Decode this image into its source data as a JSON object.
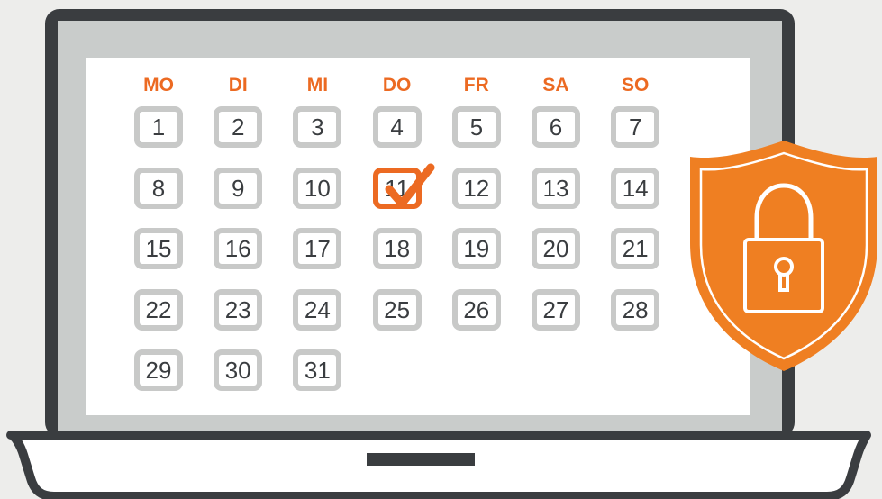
{
  "calendar": {
    "weekdays": [
      "MO",
      "DI",
      "MI",
      "DO",
      "FR",
      "SA",
      "SO"
    ],
    "rows": [
      [
        "1",
        "2",
        "3",
        "4",
        "5",
        "6",
        "7"
      ],
      [
        "8",
        "9",
        "10",
        "11",
        "12",
        "13",
        "14"
      ],
      [
        "15",
        "16",
        "17",
        "18",
        "19",
        "20",
        "21"
      ],
      [
        "22",
        "23",
        "24",
        "25",
        "26",
        "27",
        "28"
      ],
      [
        "29",
        "30",
        "31"
      ]
    ],
    "selected_day": "11"
  },
  "colors": {
    "accent": "#ec6a22",
    "laptop": "#3a3d40",
    "cell_border": "#c8c9c8",
    "bezel": "#c9cccb",
    "background": "#ededeb"
  },
  "icons": {
    "check": "checkmark-icon",
    "shield": "shield-icon",
    "lock": "padlock-icon"
  }
}
